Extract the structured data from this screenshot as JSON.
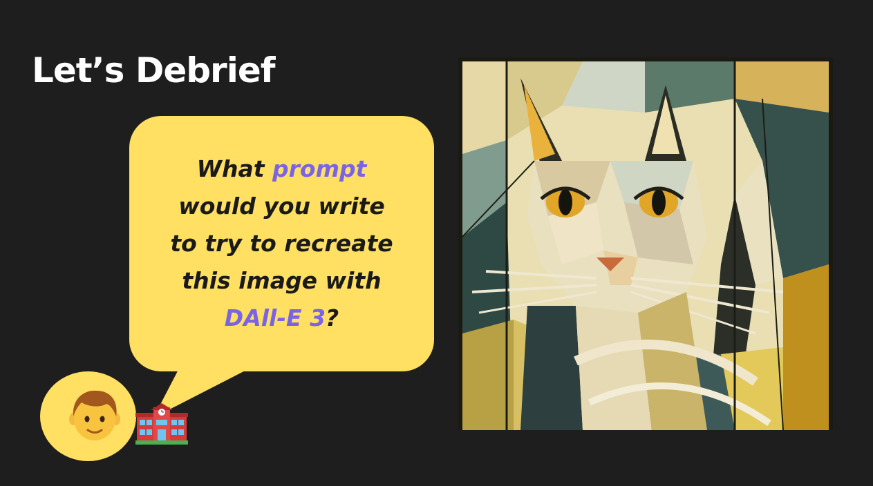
{
  "slide": {
    "title": "Let’s Debrief"
  },
  "speech_bubble": {
    "line1_part1": "What ",
    "line1_highlight": "prompt",
    "line2": "would you write",
    "line3": "to try to recreate",
    "line4": "this image with",
    "line5_highlight": "DAll-E 3",
    "line5_part2": "?"
  },
  "icons": {
    "student": "person-face-icon",
    "school": "school-building-icon"
  },
  "colors": {
    "background": "#1e1e1e",
    "bubble": "#ffe063",
    "highlight": "#7a64e6",
    "title": "#ffffff"
  }
}
